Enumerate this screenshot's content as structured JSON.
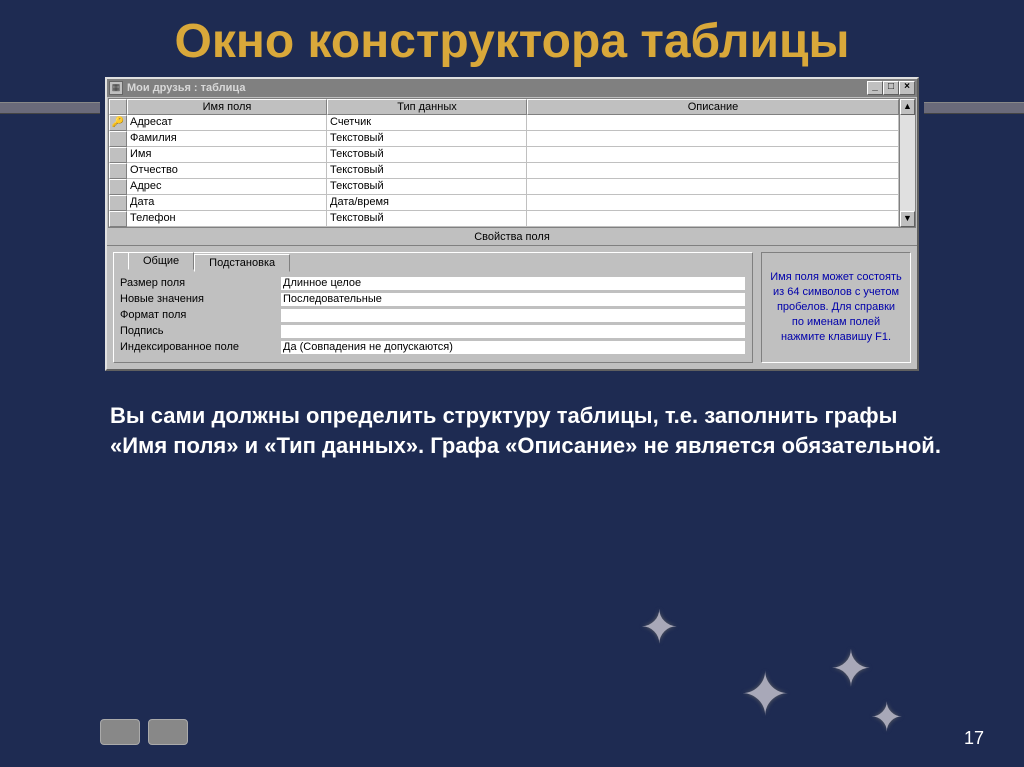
{
  "slide": {
    "title": "Окно конструктора таблицы",
    "caption": "Вы сами должны определить структуру таблицы, т.е. заполнить графы «Имя поля» и «Тип данных». Графа «Описание» не является обязательной.",
    "pageNumber": "17"
  },
  "window": {
    "title": "Мои друзья : таблица",
    "columns": {
      "name": "Имя поля",
      "type": "Тип данных",
      "desc": "Описание"
    },
    "rows": [
      {
        "selector": "🔑▸",
        "name": "Адресат",
        "type": "Счетчик",
        "desc": ""
      },
      {
        "selector": "",
        "name": "Фамилия",
        "type": "Текстовый",
        "desc": ""
      },
      {
        "selector": "",
        "name": "Имя",
        "type": "Текстовый",
        "desc": ""
      },
      {
        "selector": "",
        "name": "Отчество",
        "type": "Текстовый",
        "desc": ""
      },
      {
        "selector": "",
        "name": "Адрес",
        "type": "Текстовый",
        "desc": ""
      },
      {
        "selector": "",
        "name": "Дата",
        "type": "Дата/время",
        "desc": ""
      },
      {
        "selector": "",
        "name": "Телефон",
        "type": "Текстовый",
        "desc": ""
      }
    ],
    "propsLabel": "Свойства поля",
    "tabs": {
      "general": "Общие",
      "lookup": "Подстановка"
    },
    "props": [
      {
        "label": "Размер поля",
        "value": "Длинное целое"
      },
      {
        "label": "Новые значения",
        "value": "Последовательные"
      },
      {
        "label": "Формат поля",
        "value": ""
      },
      {
        "label": "Подпись",
        "value": ""
      },
      {
        "label": "Индексированное поле",
        "value": "Да (Совпадения не допускаются)"
      }
    ],
    "helpText": "Имя поля может состоять из 64 символов с учетом пробелов. Для справки по именам полей нажмите клавишу F1."
  }
}
